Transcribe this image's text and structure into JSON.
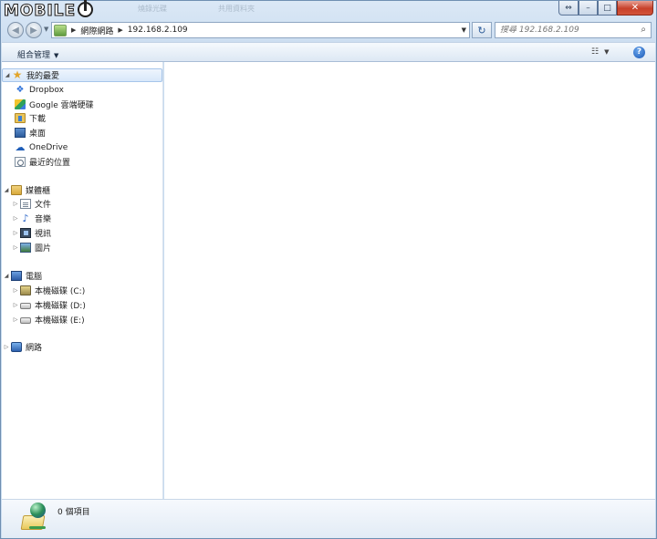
{
  "titlebar": {
    "logo_text": "MOBILE",
    "ghost_tab_1": "燒錄光碟",
    "ghost_tab_2": "共用資料夾",
    "min_glyph": "⇔",
    "restore_glyph": "–",
    "max_glyph": "□",
    "close_glyph": "✕"
  },
  "navbar": {
    "back_glyph": "◀",
    "forward_glyph": "▶",
    "breadcrumb": [
      "網際網路",
      "192.168.2.109"
    ],
    "search_placeholder": "搜尋 192.168.2.109",
    "refresh_glyph": "↻",
    "search_glyph": "⌕"
  },
  "commandbar": {
    "organize_label": "組合管理",
    "view_glyph": "☷",
    "help_glyph": "?"
  },
  "navpane": {
    "favorites": {
      "label": "我的最愛",
      "items": [
        {
          "label": "Dropbox",
          "icon": "dropbox-icon"
        },
        {
          "label": "Google 雲端硬碟",
          "icon": "google-drive-icon"
        },
        {
          "label": "下載",
          "icon": "downloads-folder-icon"
        },
        {
          "label": "桌面",
          "icon": "desktop-icon"
        },
        {
          "label": "OneDrive",
          "icon": "onedrive-icon"
        },
        {
          "label": "最近的位置",
          "icon": "recent-places-icon"
        }
      ]
    },
    "libraries": {
      "label": "媒體櫃",
      "items": [
        {
          "label": "文件",
          "icon": "documents-icon"
        },
        {
          "label": "音樂",
          "icon": "music-icon"
        },
        {
          "label": "視訊",
          "icon": "video-icon"
        },
        {
          "label": "圖片",
          "icon": "pictures-icon"
        }
      ]
    },
    "computer": {
      "label": "電腦",
      "items": [
        {
          "label": "本機磁碟 (C:)",
          "icon": "system-drive-icon"
        },
        {
          "label": "本機磁碟 (D:)",
          "icon": "local-drive-icon"
        },
        {
          "label": "本機磁碟 (E:)",
          "icon": "local-drive-icon"
        }
      ]
    },
    "network": {
      "label": "網路"
    }
  },
  "details": {
    "item_count": "0 個項目"
  }
}
